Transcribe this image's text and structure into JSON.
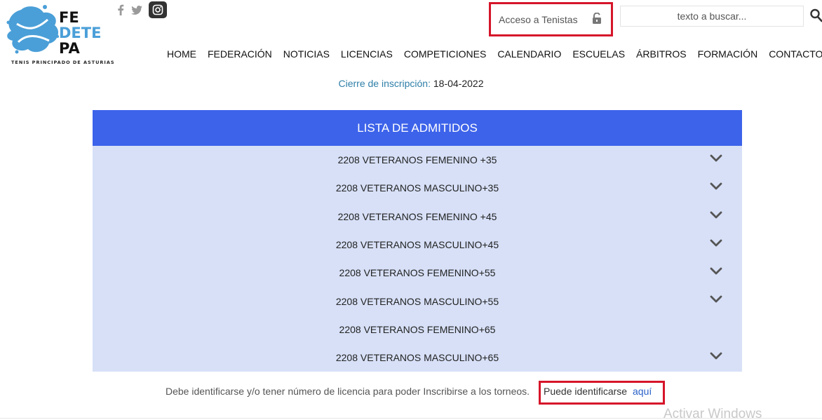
{
  "logo": {
    "line1": "FE",
    "line2": "DETE",
    "line3": "PA",
    "tagline": "TENIS PRINCIPADO DE ASTURIAS",
    "brand_color": "#4a9fd8"
  },
  "social": {
    "icons": [
      "facebook-icon",
      "twitter-icon",
      "instagram-icon"
    ]
  },
  "header": {
    "access_label": "Acceso a Tenistas",
    "access_icon": "lock-open-icon",
    "search_placeholder": "texto a buscar...",
    "search_icon": "search-icon"
  },
  "nav": {
    "items": [
      "HOME",
      "FEDERACIÓN",
      "NOTICIAS",
      "LICENCIAS",
      "COMPETICIONES",
      "CALENDARIO",
      "ESCUELAS",
      "ÁRBITROS",
      "FORMACIÓN",
      "CONTACTO"
    ]
  },
  "deadline": {
    "label": "Cierre de inscripción:",
    "value": "18-04-2022"
  },
  "panel": {
    "title": "LISTA DE ADMITIDOS",
    "header_color": "#3d63ea",
    "body_color": "#d7e0f7",
    "rows": [
      {
        "label": "2208 VETERANOS FEMENINO +35",
        "expandable": true
      },
      {
        "label": "2208 VETERANOS MASCULINO+35",
        "expandable": true
      },
      {
        "label": "2208 VETERANOS FEMENINO +45",
        "expandable": true
      },
      {
        "label": "2208 VETERANOS MASCULINO+45",
        "expandable": true
      },
      {
        "label": "2208 VETERANOS FEMENINO+55",
        "expandable": true
      },
      {
        "label": "2208 VETERANOS MASCULINO+55",
        "expandable": true
      },
      {
        "label": "2208 VETERANOS FEMENINO+65",
        "expandable": false
      },
      {
        "label": "2208 VETERANOS MASCULINO+65",
        "expandable": true
      }
    ]
  },
  "notice": {
    "text": "Debe identificarse y/o tener número de licencia para poder Inscribirse a los torneos.",
    "identify_text": "Puede identificarse",
    "link_text": "aquí"
  },
  "watermark": "Activar Windows",
  "highlight_color": "#d6152a"
}
